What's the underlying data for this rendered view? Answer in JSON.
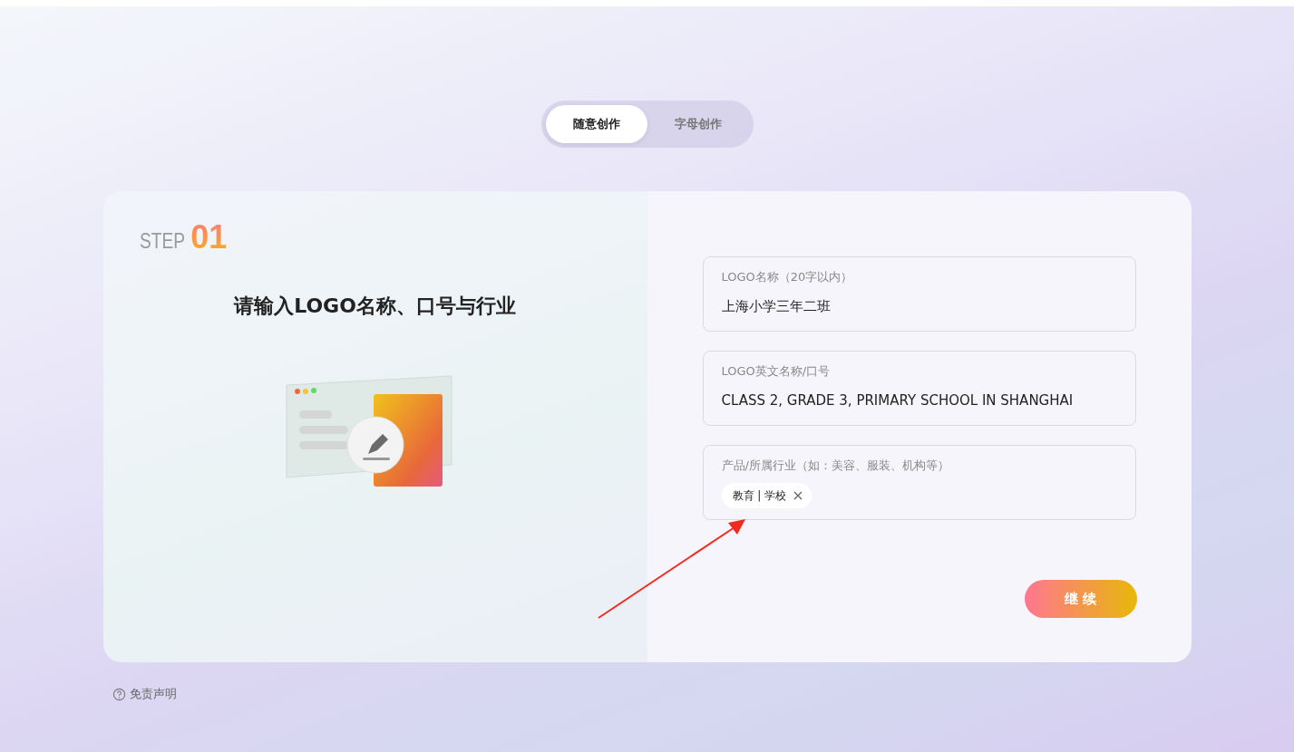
{
  "tabs": [
    {
      "label": "随意创作",
      "selected": true
    },
    {
      "label": "字母创作",
      "selected": false
    }
  ],
  "step": {
    "label": "STEP",
    "number": "01"
  },
  "heading": "请输入LOGO名称、口号与行业",
  "fields": [
    {
      "kind": "text",
      "label": "LOGO名称（20字以内）",
      "value": "上海小学三年二班"
    },
    {
      "kind": "text",
      "label": "LOGO英文名称/口号",
      "value": "CLASS 2, GRADE 3, PRIMARY SCHOOL IN SHANGHAI"
    },
    {
      "kind": "tags",
      "label": "产品/所属行业（如：美容、服装、机构等）",
      "tags": [
        "教育 | 学校"
      ]
    }
  ],
  "continue_button": "继 续",
  "disclaimer": "免责声明"
}
